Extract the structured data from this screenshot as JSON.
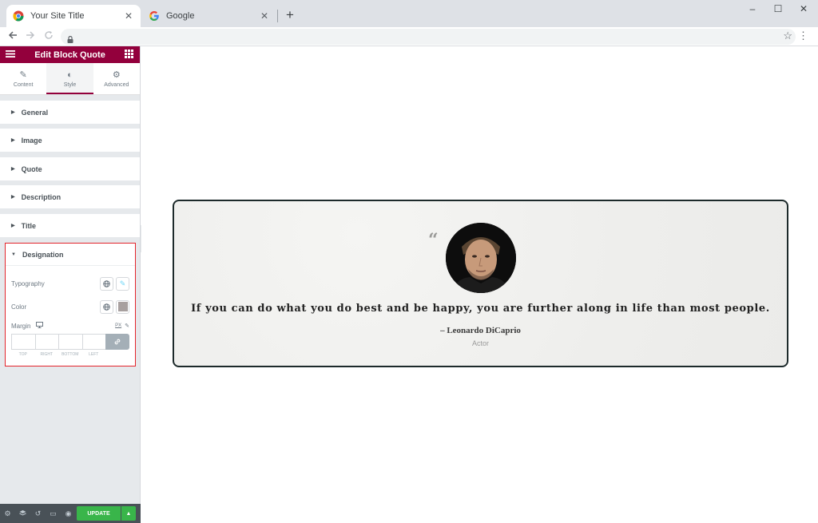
{
  "browser": {
    "tabs": [
      {
        "title": "Your Site Title",
        "active": true,
        "icon": "chrome-icon"
      },
      {
        "title": "Google",
        "active": false,
        "icon": "google-icon"
      }
    ],
    "close_glyph": "✕",
    "new_tab_glyph": "+",
    "window_controls": [
      "–",
      "☐",
      "✕"
    ]
  },
  "panel": {
    "header_title": "Edit Block Quote",
    "tabs": [
      {
        "label": "Content",
        "icon": "pencil-icon",
        "glyph": "✎"
      },
      {
        "label": "Style",
        "icon": "half-circle-icon",
        "glyph": "◐"
      },
      {
        "label": "Advanced",
        "icon": "gear-icon",
        "glyph": "⚙"
      }
    ],
    "sections": [
      "General",
      "Image",
      "Quote",
      "Description",
      "Title"
    ],
    "designation": {
      "title": "Designation",
      "typography_label": "Typography",
      "color_label": "Color",
      "color_value": "#a8a09f",
      "margin_label": "Margin",
      "margin_unit": "PX",
      "dimension_labels": [
        "TOP",
        "RIGHT",
        "BOTTOM",
        "LEFT"
      ]
    },
    "footer": {
      "update_label": "UPDATE"
    }
  },
  "quote": {
    "text": "If you can do what you do best and be happy, you are further along in life than most people.",
    "author": "– Leonardo DiCaprio",
    "designation": "Actor"
  },
  "colors": {
    "brand": "#93003c",
    "update": "#39b54a",
    "highlight_border": "#e3242b"
  }
}
